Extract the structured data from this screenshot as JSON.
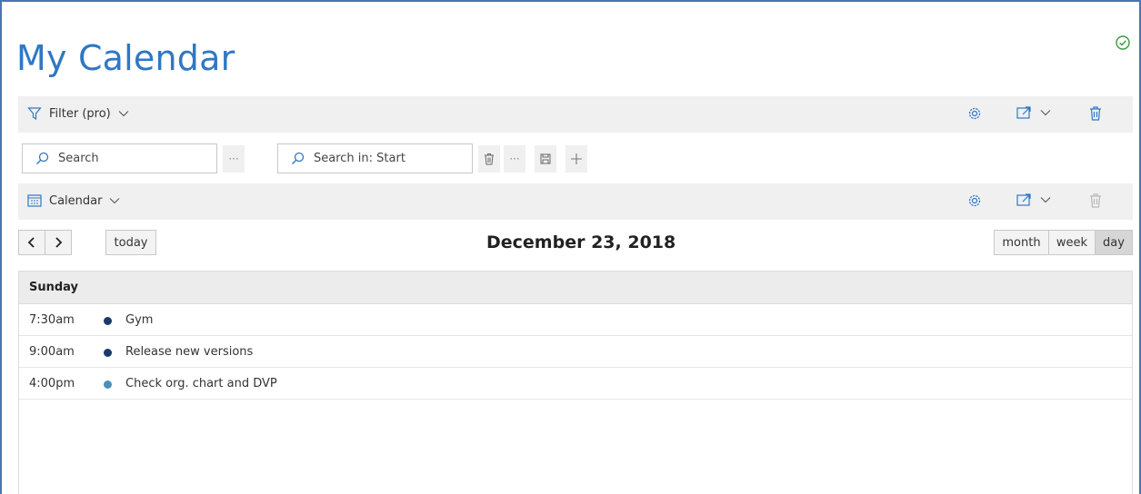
{
  "page_title": "My Calendar",
  "filter_bar": {
    "label": "Filter (pro)"
  },
  "search": {
    "placeholder": "Search",
    "search_in_label": "Search in: Start",
    "more_glyph": "···"
  },
  "calendar_bar": {
    "label": "Calendar"
  },
  "nav": {
    "prev": "‹",
    "next": "›",
    "today": "today"
  },
  "date_title": "December 23, 2018",
  "views": {
    "month": "month",
    "week": "week",
    "day": "day",
    "active": "day"
  },
  "day_header": "Sunday",
  "events": [
    {
      "time": "7:30am",
      "title": "Gym",
      "color": "#1a3a6b"
    },
    {
      "time": "9:00am",
      "title": "Release new versions",
      "color": "#1a3a6b"
    },
    {
      "time": "4:00pm",
      "title": "Check org. chart and DVP",
      "color": "#4a90b8"
    }
  ],
  "colors": {
    "accent": "#2f78c4",
    "status_ok": "#3a9a3a"
  }
}
